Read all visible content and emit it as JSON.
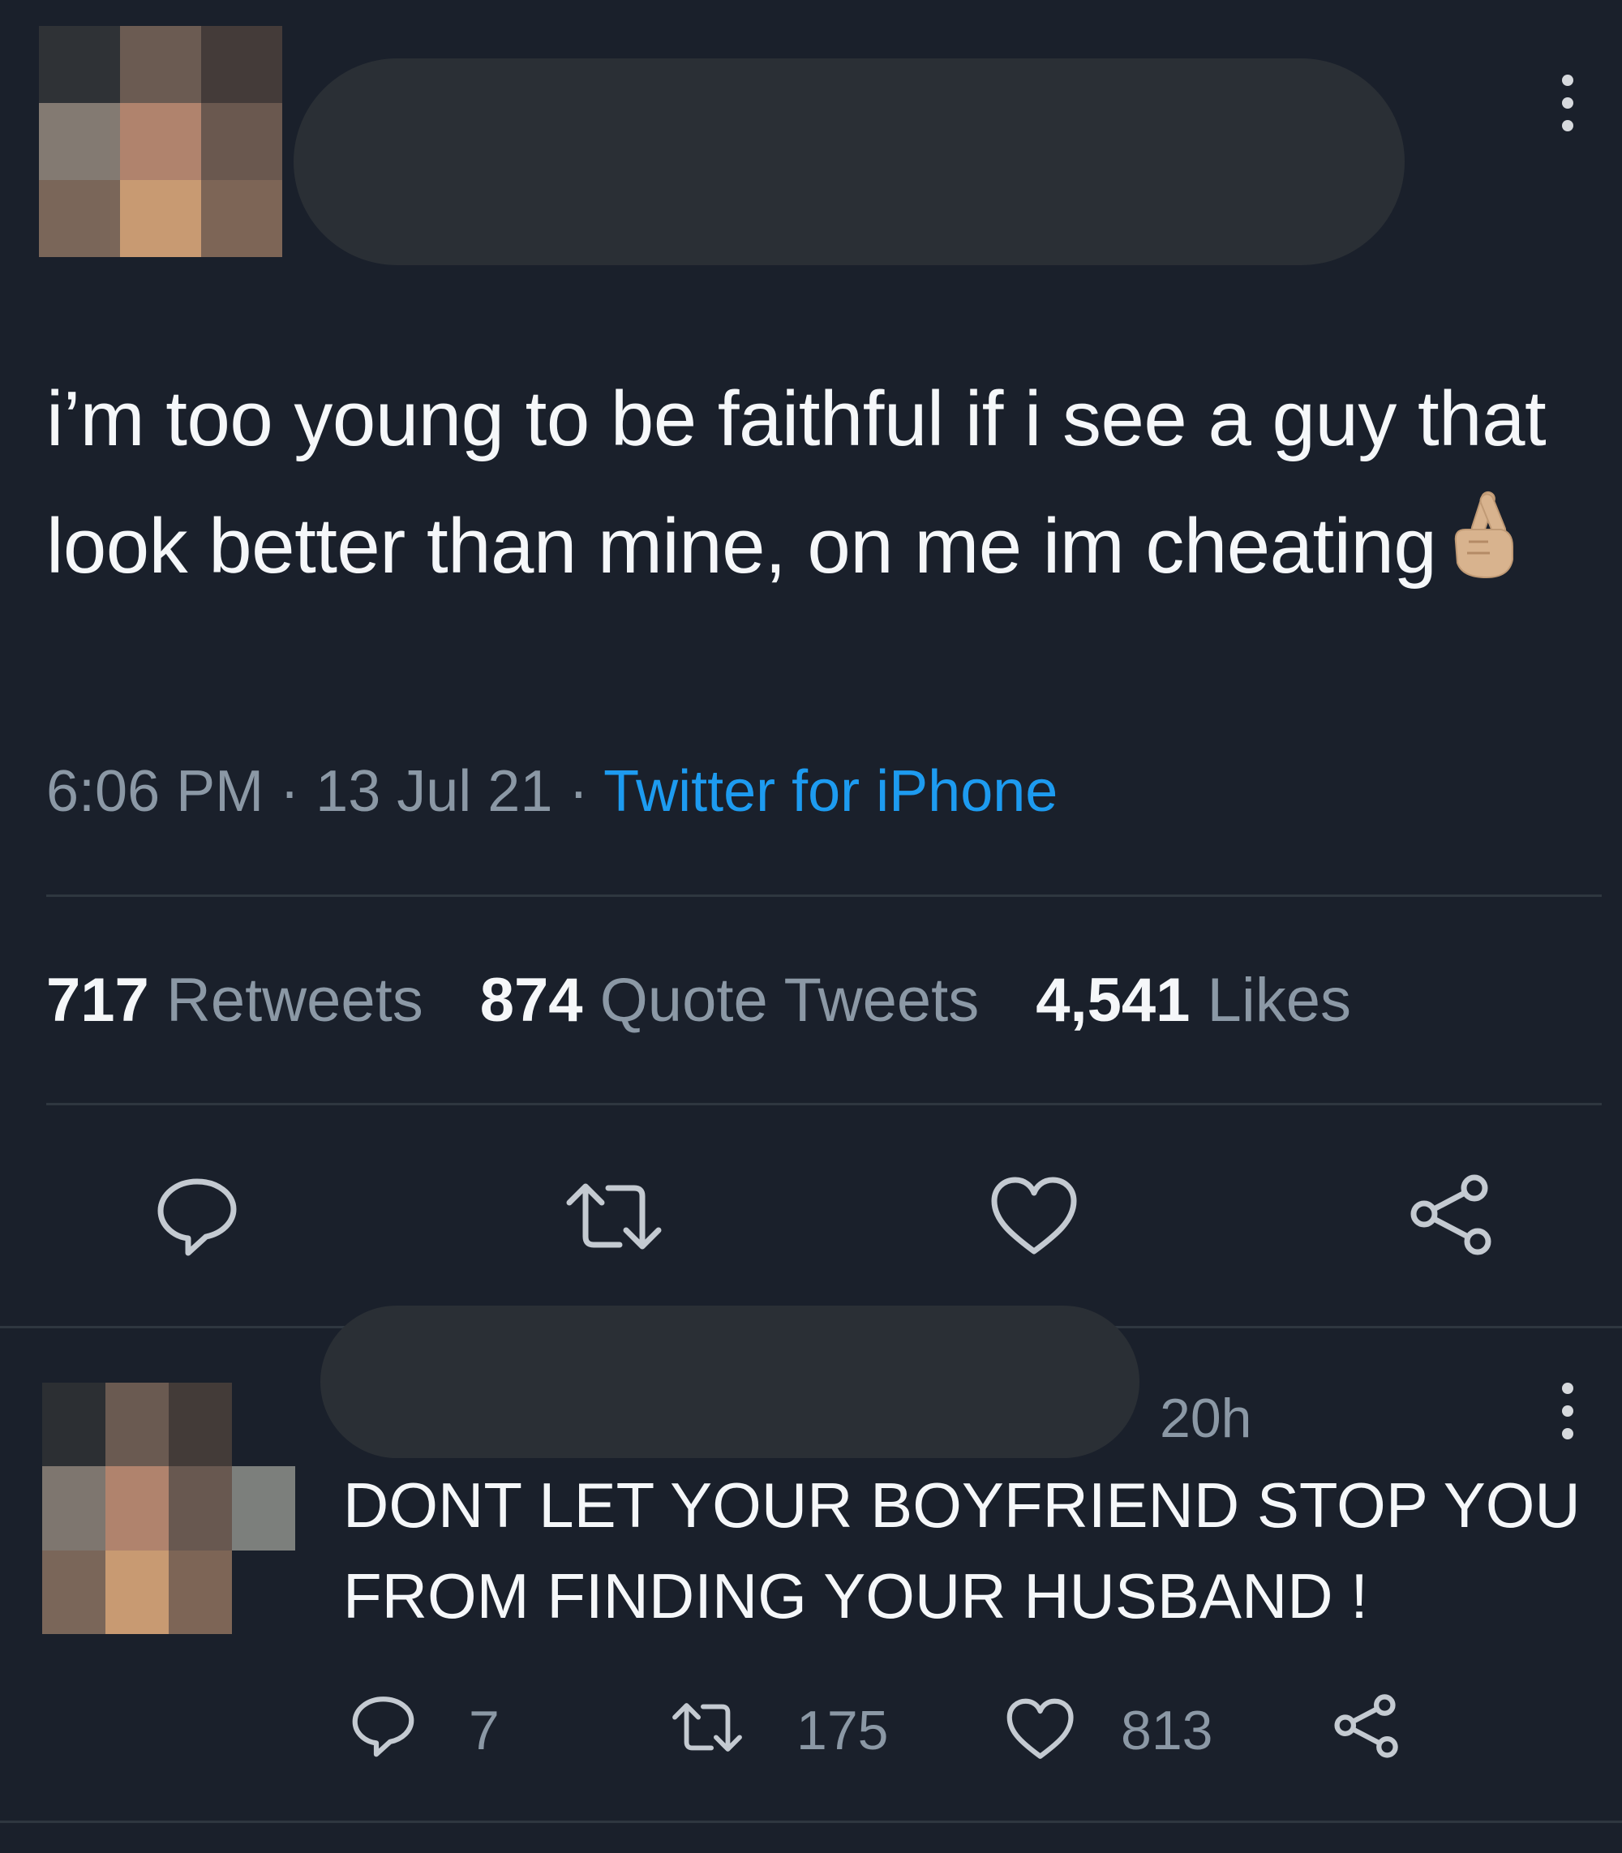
{
  "tweet": {
    "text": "i’m too young to be faithful if i see a guy that look better than mine, on me im cheating",
    "emoji": "crossed-fingers",
    "time": "6:06 PM",
    "date": "13 Jul 21",
    "separator": "·",
    "source": "Twitter for iPhone",
    "stats": {
      "retweets_count": "717",
      "retweets_label": "Retweets",
      "quotes_count": "874",
      "quotes_label": "Quote Tweets",
      "likes_count": "4,541",
      "likes_label": "Likes"
    }
  },
  "reply": {
    "time": "20h",
    "text": "DONT LET YOUR BOYFRIEND STOP YOU FROM FINDING YOUR HUSBAND !",
    "replies": "7",
    "retweets": "175",
    "likes": "813"
  },
  "colors": {
    "background": "#1a202b",
    "text": "#f5f7f9",
    "muted": "#8b98a5",
    "link": "#1d9bf0"
  }
}
